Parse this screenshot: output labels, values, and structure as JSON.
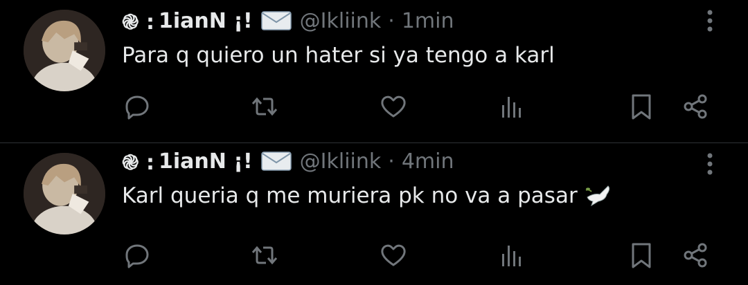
{
  "tweets": [
    {
      "name_prefix": "֎ :",
      "display_name": "1ianN ¡!",
      "handle": "@Ikliink",
      "separator": "·",
      "time": "1min",
      "text": "Para q quiero un hater si ya tengo a karl"
    },
    {
      "name_prefix": "֎ :",
      "display_name": "1ianN ¡!",
      "handle": "@Ikliink",
      "separator": "·",
      "time": "4min",
      "text": "Karl queria q me muriera pk no va a pasar"
    }
  ],
  "icons": {
    "reply": "reply-icon",
    "retweet": "retweet-icon",
    "like": "like-icon",
    "views": "views-icon",
    "bookmark": "bookmark-icon",
    "share": "share-icon",
    "more": "more-icon"
  },
  "colors": {
    "background": "#000000",
    "text": "#e7e9ea",
    "secondary": "#71767b",
    "divider": "#2f3336"
  }
}
